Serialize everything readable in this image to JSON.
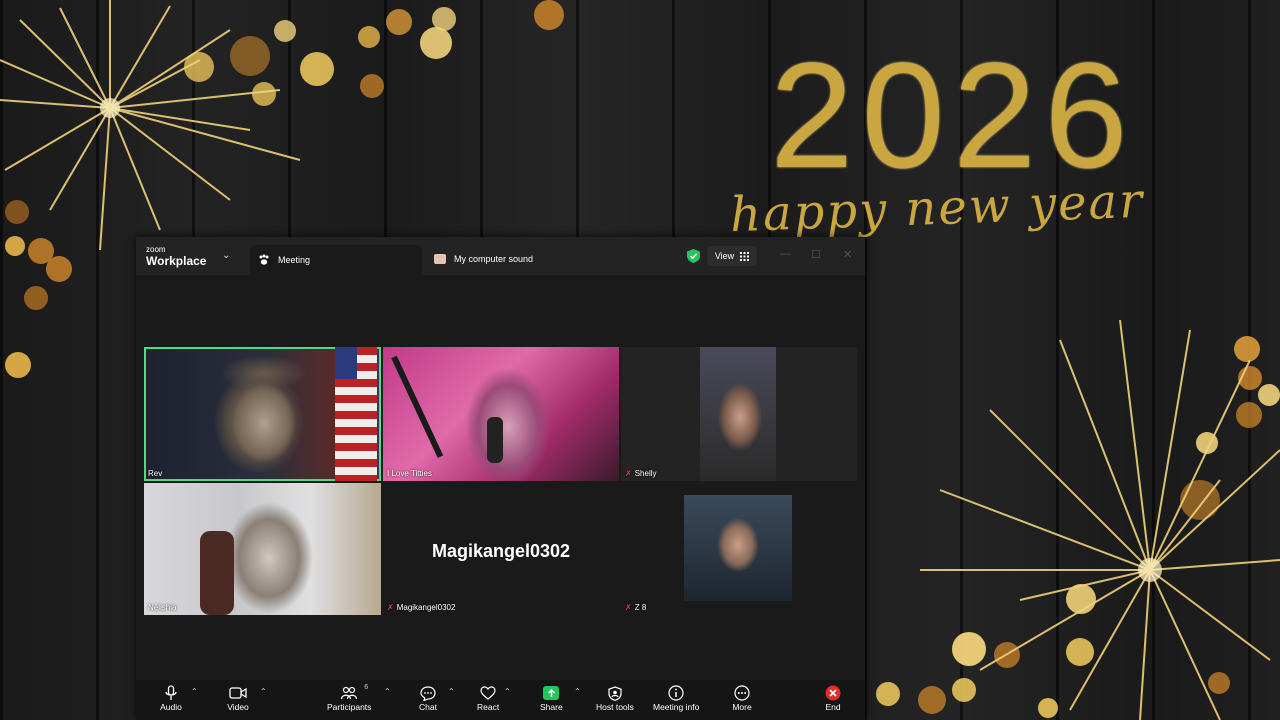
{
  "background": {
    "year": "2026",
    "greeting": "happy new year"
  },
  "titlebar": {
    "brand_small": "zoom",
    "brand": "Workplace",
    "tab_meeting": "Meeting",
    "tab_sound": "My computer sound",
    "view_label": "View"
  },
  "participants": {
    "rev": "Rev",
    "ilovetitties": "I Love Titties",
    "shelly": "Shelly",
    "nelishia": "Nelishia",
    "magikangel_center": "Magikangel0302",
    "magikangel": "Magikangel0302",
    "z8": "Z 8"
  },
  "toolbar": {
    "audio": "Audio",
    "video": "Video",
    "participants": "Participants",
    "participants_count": "6",
    "chat": "Chat",
    "react": "React",
    "share": "Share",
    "host_tools": "Host tools",
    "meeting_info": "Meeting info",
    "more": "More",
    "end": "End"
  },
  "colors": {
    "accent_gold": "#c9a640",
    "active_speaker": "#4ade80",
    "share_green": "#22c55e",
    "end_red": "#e02d2d",
    "muted_red": "#e04545"
  }
}
